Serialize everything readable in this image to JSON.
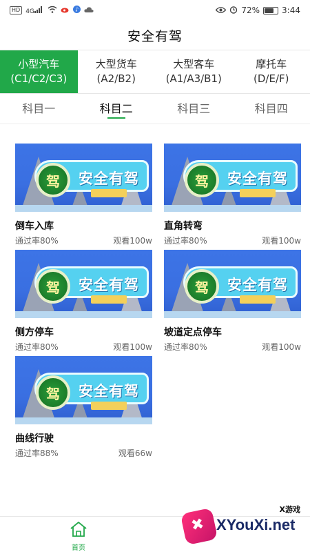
{
  "status_bar": {
    "hd": "HD",
    "signal": "4G",
    "battery": "72%",
    "battery_level": 0.72,
    "time": "3:44"
  },
  "header": {
    "title": "安全有驾"
  },
  "category_tabs": [
    {
      "name": "小型汽车",
      "code": "(C1/C2/C3)",
      "active": true
    },
    {
      "name": "大型货车",
      "code": "(A2/B2)",
      "active": false
    },
    {
      "name": "大型客车",
      "code": "(A1/A3/B1)",
      "active": false
    },
    {
      "name": "摩托车",
      "code": "(D/E/F)",
      "active": false
    }
  ],
  "subject_tabs": [
    {
      "label": "科目一",
      "active": false
    },
    {
      "label": "科目二",
      "active": true
    },
    {
      "label": "科目三",
      "active": false
    },
    {
      "label": "科目四",
      "active": false
    }
  ],
  "thumbnail": {
    "title": "安全有驾",
    "emblem": "驾"
  },
  "videos": [
    {
      "title": "倒车入库",
      "pass_rate": "通过率80%",
      "views": "观看100w"
    },
    {
      "title": "直角转弯",
      "pass_rate": "通过率80%",
      "views": "观看100w"
    },
    {
      "title": "侧方停车",
      "pass_rate": "通过率80%",
      "views": "观看100w"
    },
    {
      "title": "坡道定点停车",
      "pass_rate": "通过率80%",
      "views": "观看100w"
    },
    {
      "title": "曲线行驶",
      "pass_rate": "通过率88%",
      "views": "观看66w"
    }
  ],
  "bottom_nav": {
    "home_label": "首页",
    "home_icon": "home-icon"
  },
  "watermark": {
    "top": "X游戏",
    "main": "XYouXi.net"
  },
  "colors": {
    "accent": "#21a849"
  }
}
